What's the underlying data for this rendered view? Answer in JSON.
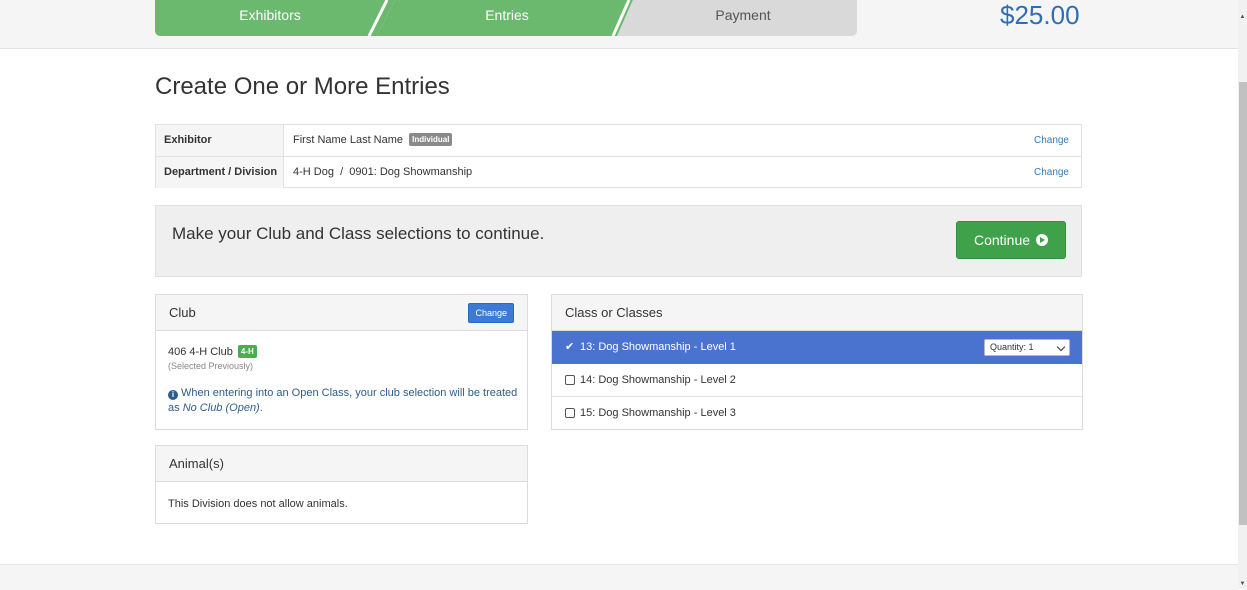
{
  "steps": [
    {
      "label": "Exhibitors",
      "state": "complete"
    },
    {
      "label": "Entries",
      "state": "current"
    },
    {
      "label": "Payment",
      "state": "pending"
    }
  ],
  "total": "$25.00",
  "page_title": "Create One or More Entries",
  "summary": {
    "exhibitor_label": "Exhibitor",
    "exhibitor_value": "First Name Last Name",
    "exhibitor_badge": "Individual",
    "division_label": "Department / Division",
    "division_value": "4-H Dog  /  0901: Dog Showmanship",
    "change_label": "Change"
  },
  "cta": {
    "message": "Make your Club and Class selections to continue.",
    "button_label": "Continue"
  },
  "club": {
    "title": "Club",
    "change_label": "Change",
    "name": "406 4-H Club",
    "badge": "4-H",
    "note": "(Selected Previously)",
    "info_prefix": "When entering into an Open Class, your club selection will be treated as ",
    "info_emphasis": "No Club (Open)",
    "info_suffix": "."
  },
  "animals": {
    "title": "Animal(s)",
    "message": "This Division does not allow animals."
  },
  "classes": {
    "title": "Class or Classes",
    "items": [
      {
        "label": "13: Dog Showmanship - Level 1",
        "checked": true,
        "quantity": "Quantity: 1"
      },
      {
        "label": "14: Dog Showmanship - Level 2",
        "checked": false
      },
      {
        "label": "15: Dog Showmanship - Level 3",
        "checked": false
      }
    ]
  },
  "colors": {
    "step_complete": "#6bb86f",
    "step_pending": "#d9d9d9",
    "accent_blue": "#4a73cf",
    "button_green": "#3fa24a",
    "total_blue": "#2f6db5"
  }
}
